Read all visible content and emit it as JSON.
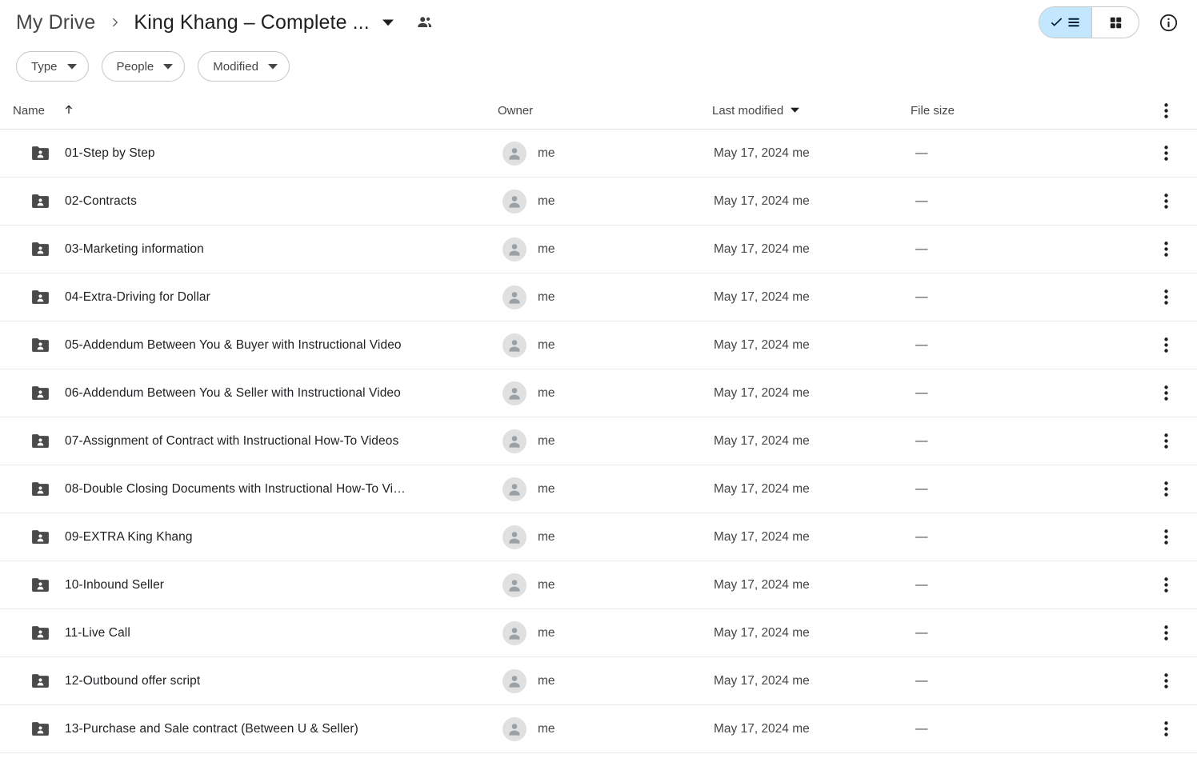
{
  "breadcrumb": {
    "root": "My Drive",
    "separator": "chevron-right-icon",
    "current": "King Khang – Complete ...",
    "caret": "dropdown-caret-icon",
    "shared_icon": "people-icon"
  },
  "topbar": {
    "list_view_label": "list-view",
    "grid_view_label": "grid-view",
    "info_label": "details-info",
    "active_view": "list",
    "active_bg": "#c2e7ff"
  },
  "filters": [
    {
      "label": "Type",
      "name": "filter-chip-type"
    },
    {
      "label": "People",
      "name": "filter-chip-people"
    },
    {
      "label": "Modified",
      "name": "filter-chip-modified"
    }
  ],
  "columns": {
    "name": "Name",
    "name_sort": "ascending",
    "owner": "Owner",
    "last_modified": "Last modified",
    "last_modified_sort": "descending",
    "file_size": "File size"
  },
  "rows": [
    {
      "name": "01-Step by Step",
      "owner": "me",
      "modified": "May 17, 2024 me",
      "size": "—",
      "icon": "shared-folder-icon"
    },
    {
      "name": "02-Contracts",
      "owner": "me",
      "modified": "May 17, 2024 me",
      "size": "—",
      "icon": "shared-folder-icon"
    },
    {
      "name": "03-Marketing information",
      "owner": "me",
      "modified": "May 17, 2024 me",
      "size": "—",
      "icon": "shared-folder-icon"
    },
    {
      "name": "04-Extra-Driving for Dollar",
      "owner": "me",
      "modified": "May 17, 2024 me",
      "size": "—",
      "icon": "shared-folder-icon"
    },
    {
      "name": "05-Addendum Between You & Buyer with Instructional Video",
      "owner": "me",
      "modified": "May 17, 2024 me",
      "size": "—",
      "icon": "shared-folder-icon"
    },
    {
      "name": "06-Addendum Between You & Seller with Instructional Video",
      "owner": "me",
      "modified": "May 17, 2024 me",
      "size": "—",
      "icon": "shared-folder-icon"
    },
    {
      "name": "07-Assignment of Contract with Instructional How-To Videos",
      "owner": "me",
      "modified": "May 17, 2024 me",
      "size": "—",
      "icon": "shared-folder-icon"
    },
    {
      "name": "08-Double Closing Documents with Instructional How-To Vi…",
      "owner": "me",
      "modified": "May 17, 2024 me",
      "size": "—",
      "icon": "shared-folder-icon"
    },
    {
      "name": "09-EXTRA King Khang",
      "owner": "me",
      "modified": "May 17, 2024 me",
      "size": "—",
      "icon": "shared-folder-icon"
    },
    {
      "name": "10-Inbound Seller",
      "owner": "me",
      "modified": "May 17, 2024 me",
      "size": "—",
      "icon": "shared-folder-icon"
    },
    {
      "name": "11-Live Call",
      "owner": "me",
      "modified": "May 17, 2024 me",
      "size": "—",
      "icon": "shared-folder-icon"
    },
    {
      "name": "12-Outbound offer script",
      "owner": "me",
      "modified": "May 17, 2024 me",
      "size": "—",
      "icon": "shared-folder-icon"
    },
    {
      "name": "13-Purchase and Sale contract (Between U & Seller)",
      "owner": "me",
      "modified": "May 17, 2024 me",
      "size": "—",
      "icon": "shared-folder-icon"
    }
  ]
}
